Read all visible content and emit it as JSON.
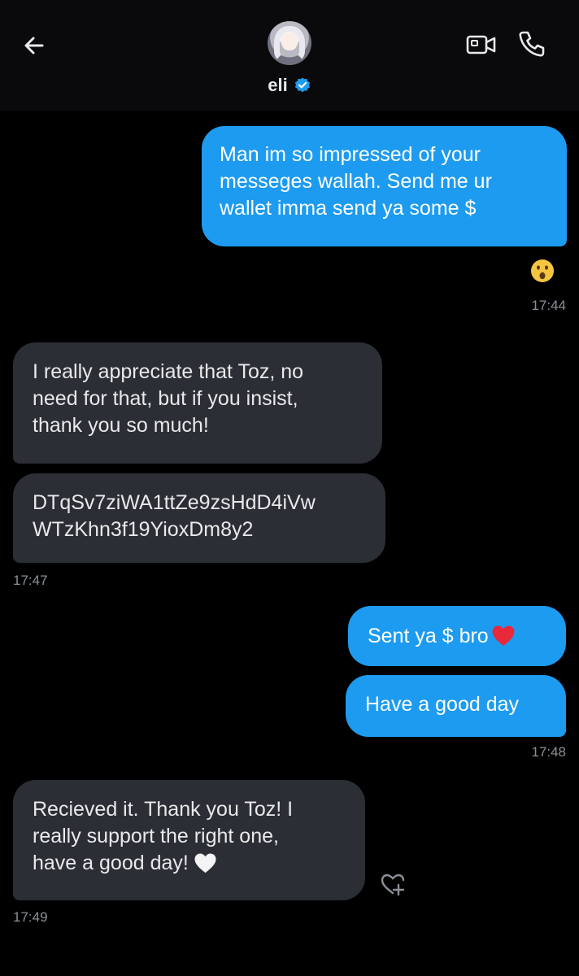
{
  "header": {
    "contact_name": "eli",
    "icons": [
      "back-arrow-icon",
      "avatar",
      "verified-badge-icon",
      "video-call-icon",
      "phone-call-icon"
    ]
  },
  "messages": [
    {
      "direction": "outgoing",
      "lines": [
        "Man im so impressed of your",
        "messeges wallah. Send me ur",
        "wallet imma send ya some $"
      ],
      "reaction": "surprised-face-emoji"
    },
    {
      "direction": "outgoing-time",
      "time": "17:44"
    },
    {
      "direction": "incoming",
      "lines": [
        "I really appreciate that Toz, no",
        "need for that, but if you insist,",
        "thank you so much!"
      ]
    },
    {
      "direction": "incoming",
      "lines": [
        "DTqSv7ziWA1ttZe9zsHdD4iVw",
        "WTzKhn3f19YioxDm8y2"
      ]
    },
    {
      "direction": "incoming-time",
      "time": "17:47"
    },
    {
      "direction": "outgoing",
      "lines": [
        "Sent ya $ bro"
      ],
      "trailing_emoji": "red-heart"
    },
    {
      "direction": "outgoing",
      "lines": [
        "Have a good day"
      ]
    },
    {
      "direction": "outgoing-time",
      "time": "17:48"
    },
    {
      "direction": "incoming",
      "lines": [
        "Recieved it. Thank you Toz! I",
        "really support the right one,",
        "have a good day!"
      ],
      "trailing_emoji": "white-heart"
    },
    {
      "direction": "incoming-time",
      "time": "17:49"
    }
  ],
  "colors": {
    "background": "#000000",
    "header_background": "#0a0a0c",
    "outgoing_bubble": "#1d9bf0",
    "incoming_bubble": "#2b2e34",
    "timestamp": "#8b9098",
    "verified_badge": "#1d9bf0"
  }
}
